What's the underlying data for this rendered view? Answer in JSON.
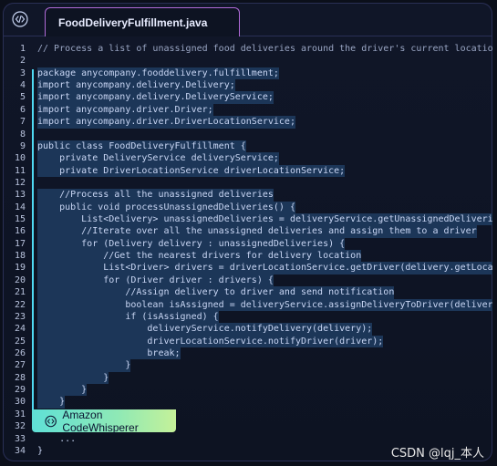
{
  "tab": {
    "filename": "FoodDeliveryFulfillment.java"
  },
  "badge": {
    "label": "Amazon CodeWhisperer"
  },
  "watermark": "CSDN @lqj_本人",
  "colors": {
    "selection": "#1c3658",
    "accent": "#4fd9f2",
    "tab_border": "#b06ad8"
  },
  "code_lines": [
    {
      "n": "1",
      "text": "// Process a list of unassigned food deliveries around the driver's current location",
      "hl": false,
      "comment": true
    },
    {
      "n": "2",
      "text": "",
      "hl": false
    },
    {
      "n": "3",
      "text": "package anycompany.fooddelivery.fulfillment;",
      "hl": true
    },
    {
      "n": "4",
      "text": "import anycompany.delivery.Delivery;",
      "hl": true
    },
    {
      "n": "5",
      "text": "import anycompany.delivery.DeliveryService;",
      "hl": true
    },
    {
      "n": "6",
      "text": "import anycompany.driver.Driver;",
      "hl": true
    },
    {
      "n": "7",
      "text": "import anycompany.driver.DriverLocationService;",
      "hl": true
    },
    {
      "n": "8",
      "text": "",
      "hl": false
    },
    {
      "n": "9",
      "text": "public class FoodDeliveryFulfillment {",
      "hl": true
    },
    {
      "n": "10",
      "text": "    private DeliveryService deliveryService;",
      "hl": true
    },
    {
      "n": "11",
      "text": "    private DriverLocationService driverLocationService;",
      "hl": true
    },
    {
      "n": "12",
      "text": "",
      "hl": false
    },
    {
      "n": "13",
      "text": "    //Process all the unassigned deliveries",
      "hl": true
    },
    {
      "n": "14",
      "text": "    public void processUnassignedDeliveries() {",
      "hl": true
    },
    {
      "n": "15",
      "text": "        List<Delivery> unassignedDeliveries = deliveryService.getUnassignedDeliveries();",
      "hl": true
    },
    {
      "n": "16",
      "text": "        //Iterate over all the unassigned deliveries and assign them to a driver",
      "hl": true
    },
    {
      "n": "17",
      "text": "        for (Delivery delivery : unassignedDeliveries) {",
      "hl": true
    },
    {
      "n": "18",
      "text": "            //Get the nearest drivers for delivery location",
      "hl": true
    },
    {
      "n": "19",
      "text": "            List<Driver> drivers = driverLocationService.getDriver(delivery.getLocation());",
      "hl": true
    },
    {
      "n": "20",
      "text": "            for (Driver driver : drivers) {",
      "hl": true
    },
    {
      "n": "21",
      "text": "                //Assign delivery to driver and send notification",
      "hl": true
    },
    {
      "n": "22",
      "text": "                boolean isAssigned = deliveryService.assignDeliveryToDriver(delivery, driver);",
      "hl": true
    },
    {
      "n": "23",
      "text": "                if (isAssigned) {",
      "hl": true
    },
    {
      "n": "24",
      "text": "                    deliveryService.notifyDelivery(delivery);",
      "hl": true
    },
    {
      "n": "25",
      "text": "                    driverLocationService.notifyDriver(driver);",
      "hl": true
    },
    {
      "n": "26",
      "text": "                    break;",
      "hl": true
    },
    {
      "n": "27",
      "text": "                }",
      "hl": true
    },
    {
      "n": "28",
      "text": "            }",
      "hl": true
    },
    {
      "n": "29",
      "text": "        }",
      "hl": true
    },
    {
      "n": "30",
      "text": "    }",
      "hl": true
    },
    {
      "n": "31",
      "text": "",
      "hl": false
    },
    {
      "n": "32",
      "text": "",
      "hl": false
    },
    {
      "n": "33",
      "text": "    ...",
      "hl": false
    },
    {
      "n": "34",
      "text": "}",
      "hl": false
    }
  ]
}
